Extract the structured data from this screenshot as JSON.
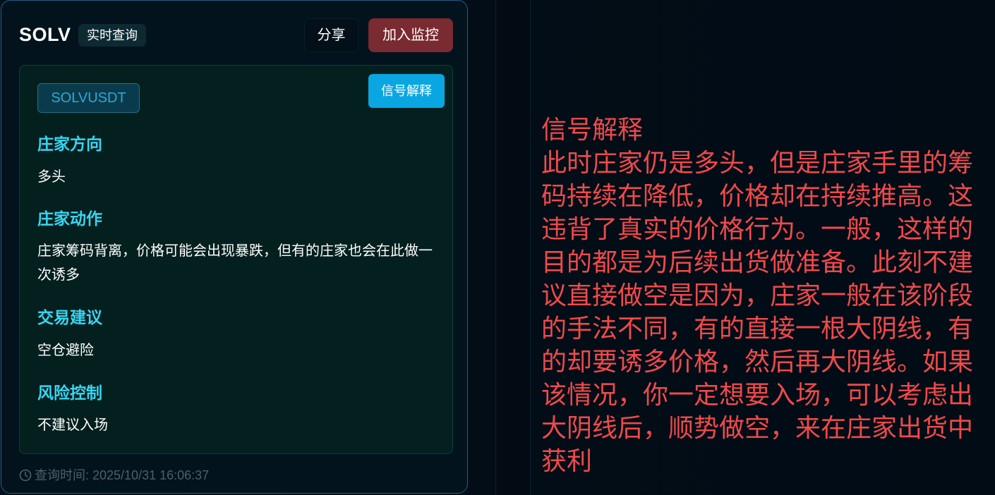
{
  "header": {
    "symbol": "SOLV",
    "badge": "实时查询",
    "share_label": "分享",
    "monitor_label": "加入监控"
  },
  "panel": {
    "pair": "SOLVUSDT",
    "explain_button_label": "信号解释",
    "sections": [
      {
        "heading": "庄家方向",
        "text": "多头"
      },
      {
        "heading": "庄家动作",
        "text": "庄家筹码背离，价格可能会出现暴跌，但有的庄家也会在此做一次诱多"
      },
      {
        "heading": "交易建议",
        "text": "空仓避险"
      },
      {
        "heading": "风险控制",
        "text": "不建议入场"
      }
    ]
  },
  "footer": {
    "clock_icon": "clock-icon",
    "query_time": "查询时间: 2025/10/31 16:06:37"
  },
  "explanation": {
    "title": "信号解释",
    "body": "此时庄家仍是多头，但是庄家手里的筹码持续在降低，价格却在持续推高。这违背了真实的价格行为。一般，这样的目的都是为后续出货做准备。此刻不建议直接做空是因为，庄家一般在该阶段的手法不同，有的直接一根大阴线，有的却要诱多价格，然后再大阴线。如果该情况，你一定想要入场，可以考虑出大阴线后，顺势做空，来在庄家出货中获利"
  },
  "colors": {
    "accent_cyan": "#3ad4ef",
    "monitor_red": "#7a2a31",
    "explain_blue": "#0aa6e2",
    "explanation_text": "#ef4a4b"
  }
}
